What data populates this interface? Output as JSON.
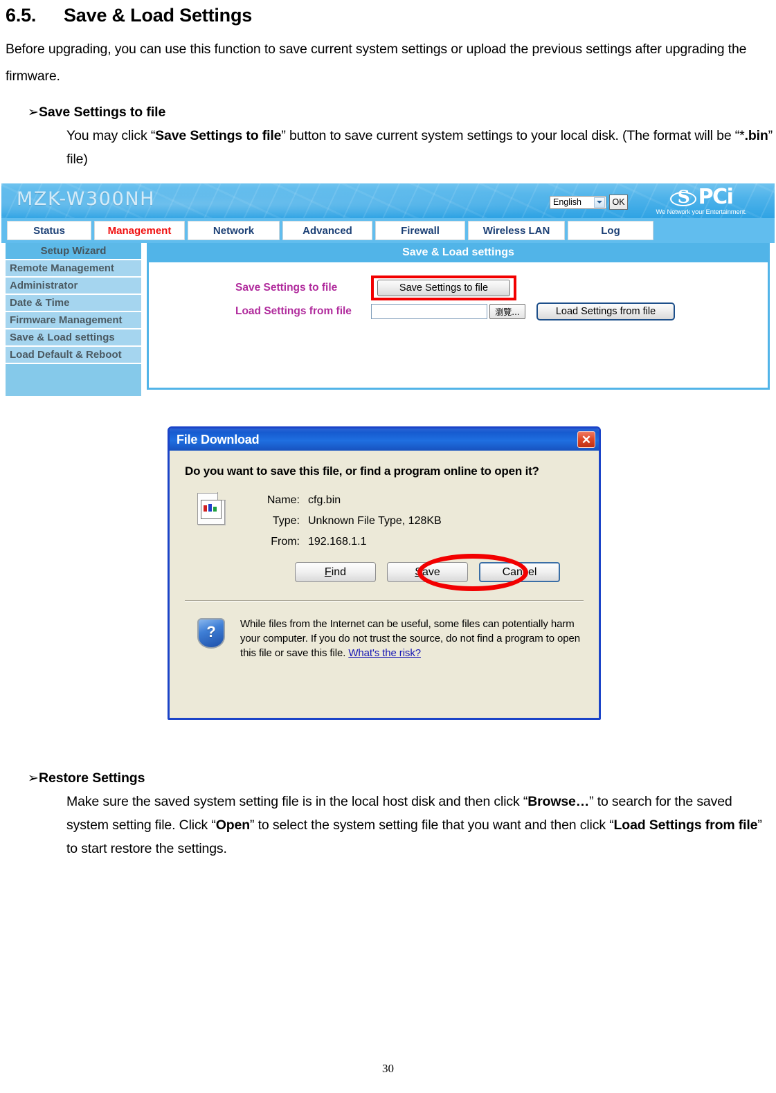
{
  "document": {
    "section_number": "6.5.",
    "section_title": "Save & Load Settings",
    "intro_paragraph": "Before upgrading, you can use this function to save current system settings or upload the previous settings after upgrading the firmware.",
    "bullet_glyph": "➢",
    "bullets": [
      {
        "heading": "Save Settings to file",
        "body_parts": [
          {
            "text": "You may click “",
            "bold": false
          },
          {
            "text": "Save Settings to file",
            "bold": true
          },
          {
            "text": "” button to save current system settings to your local disk. (The format will be “*",
            "bold": false
          },
          {
            "text": ".bin",
            "bold": true
          },
          {
            "text": "” file)",
            "bold": false
          }
        ]
      },
      {
        "heading": "Restore Settings",
        "body_parts": [
          {
            "text": "Make sure the saved system setting file is in the local host disk and then click “",
            "bold": false
          },
          {
            "text": "Browse…",
            "bold": true
          },
          {
            "text": "” to search for the saved system setting file. Click “",
            "bold": false
          },
          {
            "text": "Open",
            "bold": true
          },
          {
            "text": "” to select the system setting file that you want and then click “",
            "bold": false
          },
          {
            "text": "Load Settings from file",
            "bold": true
          },
          {
            "text": "” to start restore the settings.",
            "bold": false
          }
        ]
      }
    ],
    "page_number": "30"
  },
  "router_ui": {
    "model_name": "MZK-W300NH",
    "language_select": {
      "value": "English",
      "caret_icon": "chevron-down-icon"
    },
    "ok_button": "OK",
    "brand": {
      "mark_letter": "S",
      "name": "PCi",
      "tagline": "We Network your Entertainment."
    },
    "tabs": [
      {
        "label": "Status",
        "active": false
      },
      {
        "label": "Management",
        "active": true
      },
      {
        "label": "Network",
        "active": false
      },
      {
        "label": "Advanced",
        "active": false
      },
      {
        "label": "Firewall",
        "active": false
      },
      {
        "label": "Wireless LAN",
        "active": false
      },
      {
        "label": "Log",
        "active": false
      }
    ],
    "sidebar": [
      {
        "label": "Setup Wizard",
        "active": true
      },
      {
        "label": "Remote Management",
        "active": false
      },
      {
        "label": "Administrator",
        "active": false
      },
      {
        "label": "Date & Time",
        "active": false
      },
      {
        "label": "Firmware Management",
        "active": false
      },
      {
        "label": "Save & Load settings",
        "active": false
      },
      {
        "label": "Load Default & Reboot",
        "active": false
      }
    ],
    "panel_title": "Save & Load settings",
    "form": {
      "save_row_label": "Save Settings to file",
      "save_button": "Save Settings to file",
      "load_row_label": "Load Settings from file",
      "file_path_value": "",
      "file_path_placeholder": "",
      "browse_button": "瀏覽...",
      "load_button": "Load Settings from file"
    },
    "colors": {
      "header_blue": "#51b4e8",
      "sidebar_blue": "#a5d5ef",
      "sidebar_active": "#5cb9e8",
      "label_magenta": "#b02a9c",
      "active_tab_red": "#f01010",
      "highlight_red": "#f20000"
    }
  },
  "file_download_dialog": {
    "title": "File Download",
    "close_icon": "close-icon",
    "question": "Do you want to save this file, or find a program online to open it?",
    "file_icon": "file-icon",
    "fields": [
      {
        "key": "Name:",
        "value": "cfg.bin"
      },
      {
        "key": "Type:",
        "value": "Unknown File Type, 128KB"
      },
      {
        "key": "From:",
        "value": "192.168.1.1"
      }
    ],
    "buttons": [
      {
        "label": "Find",
        "accel": "F",
        "highlighted": false
      },
      {
        "label": "Save",
        "accel": "S",
        "highlighted": true
      },
      {
        "label": "Cancel",
        "accel": "",
        "highlighted": false
      }
    ],
    "warning_icon": "shield-question-icon",
    "warning_text": "While files from the Internet can be useful, some files can potentially harm your computer. If you do not trust the source, do not find a program to open this file or save this file. ",
    "warning_link": "What's the risk?"
  }
}
